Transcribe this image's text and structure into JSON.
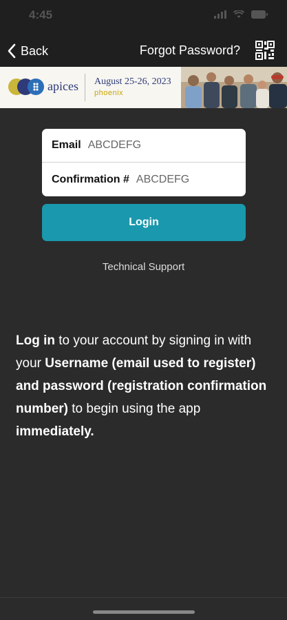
{
  "status_bar": {
    "time": "4:45"
  },
  "nav": {
    "back_label": "Back",
    "forgot_label": "Forgot Password?"
  },
  "banner": {
    "brand": "apices",
    "event_date": "August 25-26, 2023",
    "event_city": "phoenix"
  },
  "form": {
    "email_label": "Email",
    "email_value": "ABCDEFG",
    "confirmation_label": "Confirmation #",
    "confirmation_value": "ABCDEFG",
    "login_label": "Login"
  },
  "support_link": "Technical Support",
  "info": {
    "part1": "Log in",
    "part2": " to your account by signing in with your ",
    "part3": "Username (email used to register) and password (registration confirmation number)",
    "part4": " to begin using the app ",
    "part5": "immediately."
  },
  "colors": {
    "background": "#2b2b2b",
    "header": "#1f1f1f",
    "accent": "#1a98ad",
    "brand": "#2e3a7a"
  }
}
